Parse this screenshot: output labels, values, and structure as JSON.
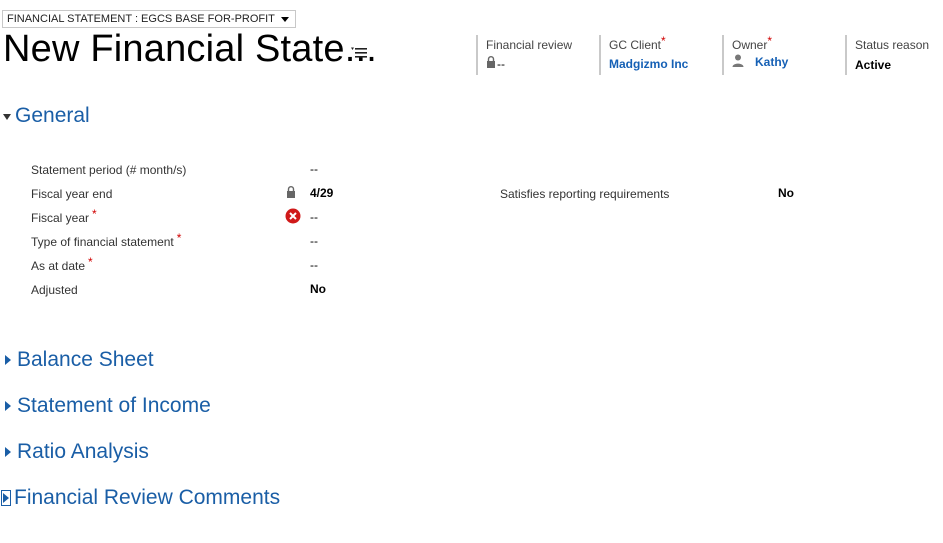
{
  "form_selector": {
    "label": "FINANCIAL STATEMENT : EGCS BASE FOR-PROFIT"
  },
  "record": {
    "title": "New Financial State..."
  },
  "header_fields": [
    {
      "label": "Financial review",
      "required": "",
      "value": "--"
    },
    {
      "label": "GC Client",
      "required": "*",
      "value": "Madgizmo Inc"
    },
    {
      "label": "Owner",
      "required": "*",
      "value": "Kathy"
    },
    {
      "label": "Status reason",
      "required": "",
      "value": "Active"
    }
  ],
  "sections": {
    "general": "General",
    "balance_sheet": "Balance Sheet",
    "income": "Statement of Income",
    "ratio": "Ratio Analysis",
    "comments": "Financial Review Comments"
  },
  "general_fields": [
    {
      "label": "Statement period (# month/s)",
      "required": "",
      "value": "--"
    },
    {
      "label": "Fiscal year end",
      "required": "",
      "value": "4/29"
    },
    {
      "label": "Fiscal year",
      "required": "*",
      "value": "--"
    },
    {
      "label": "Type of financial statement",
      "required": "*",
      "value": "--"
    },
    {
      "label": "As at date",
      "required": "*",
      "value": "--"
    },
    {
      "label": "Adjusted",
      "required": "",
      "value": "No"
    }
  ],
  "right_fields": [
    {
      "label": "Satisfies reporting requirements",
      "value": "No"
    }
  ],
  "icons": {
    "lock": "lock-icon",
    "error": "error-icon",
    "user": "user-icon",
    "menu": "menu-icon"
  },
  "colors": {
    "section_heading": "#1a5ea6",
    "link": "#1560b5",
    "required": "#d00000",
    "error": "#d01919"
  }
}
